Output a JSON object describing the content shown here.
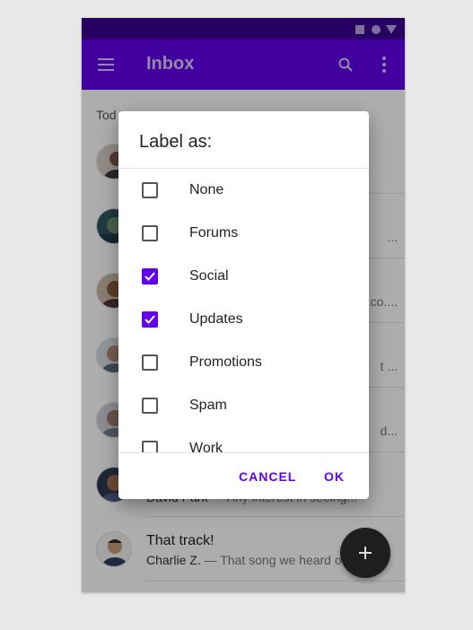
{
  "app_bar": {
    "title": "Inbox",
    "color": "#6200ee",
    "status_bar_color": "#3c0090",
    "icons": [
      "menu-icon",
      "search-icon",
      "more-vert-icon"
    ]
  },
  "list": {
    "section_header": "Tod",
    "rows": [
      {
        "title": "",
        "sender": "",
        "snippet": "",
        "side": ""
      },
      {
        "title": "",
        "sender": "",
        "snippet": "",
        "side": "..."
      },
      {
        "title": "",
        "sender": "",
        "snippet": "",
        "side": "co...."
      },
      {
        "title": "",
        "sender": "",
        "snippet": "",
        "side": "t ..."
      },
      {
        "title": "",
        "sender": "",
        "snippet": "",
        "side": "d..."
      },
      {
        "title": "",
        "sender": "David Park",
        "snippet": " — Any interest in seeing...",
        "side": ""
      },
      {
        "title": "That track!",
        "sender": "Charlie Z.",
        "snippet": " — That song we heard o",
        "side": ""
      }
    ]
  },
  "dialog": {
    "title": "Label as:",
    "options": [
      {
        "label": "None",
        "checked": false
      },
      {
        "label": "Forums",
        "checked": false
      },
      {
        "label": "Social",
        "checked": true
      },
      {
        "label": "Updates",
        "checked": true
      },
      {
        "label": "Promotions",
        "checked": false
      },
      {
        "label": "Spam",
        "checked": false
      },
      {
        "label": "Work",
        "checked": false
      }
    ],
    "cancel_label": "CANCEL",
    "ok_label": "OK",
    "accent": "#6200ee"
  },
  "fab": {
    "icon": "plus-icon"
  }
}
